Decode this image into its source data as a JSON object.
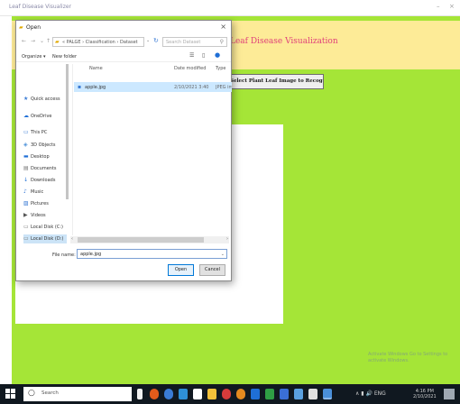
{
  "app_window": {
    "title": "Leaf Disease Visualizer",
    "minimize_glyph": "–",
    "close_glyph": "×",
    "header_title": "Leaf Disease Visualization",
    "action_button_label": "Select Plant Leaf Image to Recognize Disease Classification",
    "footer_note": "Activate Windows Go to Settings to activate Windows."
  },
  "dialog": {
    "title": "Open",
    "address_path": "« PALGE › Classification › Dataset",
    "search_placeholder": "Search Dataset",
    "organize_label": "Organize ▾",
    "new_folder_label": "New folder",
    "nav_items": [
      {
        "icon": "★",
        "label": "Quick access"
      },
      {
        "icon": "☁",
        "label": "OneDrive"
      },
      {
        "icon": "▭",
        "label": "This PC"
      },
      {
        "icon": "◈",
        "label": "3D Objects"
      },
      {
        "icon": "▬",
        "label": "Desktop"
      },
      {
        "icon": "▤",
        "label": "Documents"
      },
      {
        "icon": "↓",
        "label": "Downloads"
      },
      {
        "icon": "♪",
        "label": "Music"
      },
      {
        "icon": "▨",
        "label": "Pictures"
      },
      {
        "icon": "▶",
        "label": "Videos"
      },
      {
        "icon": "▭",
        "label": "Local Disk (C:)"
      },
      {
        "icon": "▭",
        "label": "Local Disk (D:)"
      }
    ],
    "columns": {
      "name": "Name",
      "date": "Date modified",
      "type": "Type"
    },
    "files": [
      {
        "name": "apple.jpg",
        "date": "2/10/2021 3:40",
        "type": "JPEG image"
      }
    ],
    "filename_label": "File name:",
    "filename_value": "apple.jpg",
    "open_label": "Open",
    "cancel_label": "Cancel"
  },
  "taskbar": {
    "search_text": "Search",
    "clock_time": "4:16 PM",
    "clock_date": "2/10/2021",
    "tray_text": "∧ ▮ 🔊 ENG"
  },
  "colors": {
    "app_background": "#a5e537",
    "header_background": "#fdeb97",
    "header_text": "#e0407a",
    "selection": "#cce8ff",
    "taskbar": "#101820"
  }
}
